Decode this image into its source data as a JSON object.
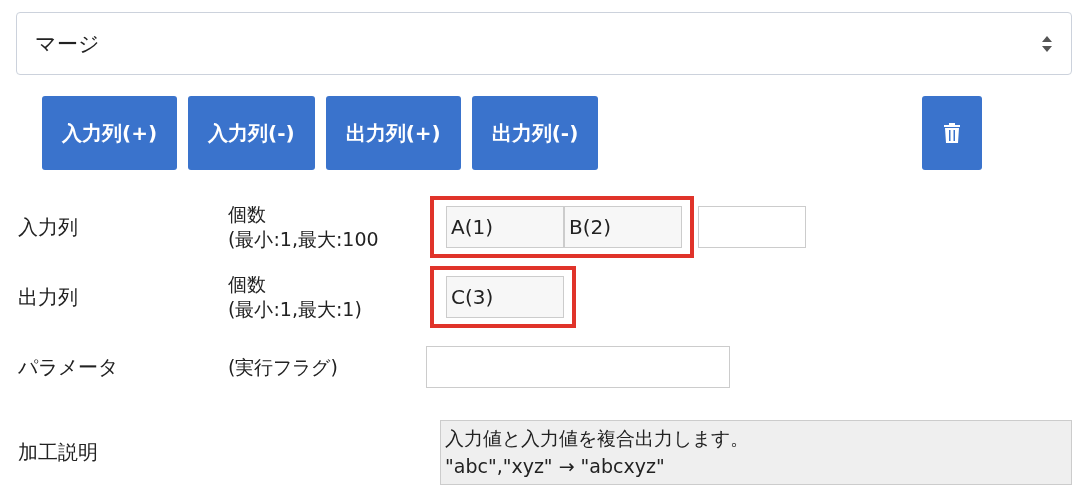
{
  "select": {
    "value": "マージ"
  },
  "buttons": [
    {
      "kind": "text",
      "label": "入力列(+)"
    },
    {
      "kind": "text",
      "label": "入力列(-)"
    },
    {
      "kind": "text",
      "label": "出力列(+)"
    },
    {
      "kind": "text",
      "label": "出力列(-)"
    },
    {
      "kind": "trash"
    }
  ],
  "rows": [
    {
      "label": "入力列",
      "hint": [
        "個数",
        "(最小:1,最大:100"
      ],
      "groups": [
        {
          "highlighted": true,
          "fields": [
            {
              "kind": "filled",
              "value": "A(1)"
            },
            {
              "kind": "filled",
              "value": "B(2)"
            }
          ]
        },
        {
          "highlighted": false,
          "fields": [
            {
              "kind": "empty"
            }
          ]
        }
      ]
    },
    {
      "label": "出力列",
      "hint": [
        "個数",
        "(最小:1,最大:1)"
      ],
      "groups": [
        {
          "highlighted": true,
          "fields": [
            {
              "kind": "filled",
              "value": "C(3)"
            }
          ]
        }
      ]
    },
    {
      "label": "パラメータ",
      "hint": [
        "(実行フラグ)"
      ],
      "groups": [
        {
          "highlighted": false,
          "fields": [
            {
              "kind": "wide"
            }
          ]
        }
      ]
    }
  ],
  "description": {
    "label": "加工説明",
    "lines": [
      "入力値と入力値を複合出力します。",
      "\"abc\",\"xyz\" → \"abcxyz\""
    ]
  }
}
